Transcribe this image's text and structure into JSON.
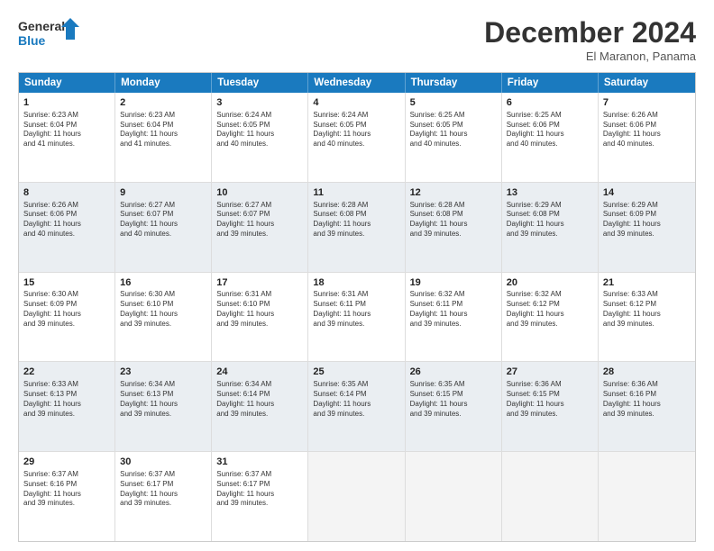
{
  "logo": {
    "line1": "General",
    "line2": "Blue"
  },
  "title": "December 2024",
  "location": "El Maranon, Panama",
  "days_of_week": [
    "Sunday",
    "Monday",
    "Tuesday",
    "Wednesday",
    "Thursday",
    "Friday",
    "Saturday"
  ],
  "weeks": [
    [
      {
        "day": "1",
        "sunrise": "6:23 AM",
        "sunset": "6:04 PM",
        "daylight": "11 hours and 41 minutes."
      },
      {
        "day": "2",
        "sunrise": "6:23 AM",
        "sunset": "6:04 PM",
        "daylight": "11 hours and 41 minutes."
      },
      {
        "day": "3",
        "sunrise": "6:24 AM",
        "sunset": "6:05 PM",
        "daylight": "11 hours and 40 minutes."
      },
      {
        "day": "4",
        "sunrise": "6:24 AM",
        "sunset": "6:05 PM",
        "daylight": "11 hours and 40 minutes."
      },
      {
        "day": "5",
        "sunrise": "6:25 AM",
        "sunset": "6:05 PM",
        "daylight": "11 hours and 40 minutes."
      },
      {
        "day": "6",
        "sunrise": "6:25 AM",
        "sunset": "6:06 PM",
        "daylight": "11 hours and 40 minutes."
      },
      {
        "day": "7",
        "sunrise": "6:26 AM",
        "sunset": "6:06 PM",
        "daylight": "11 hours and 40 minutes."
      }
    ],
    [
      {
        "day": "8",
        "sunrise": "6:26 AM",
        "sunset": "6:06 PM",
        "daylight": "11 hours and 40 minutes."
      },
      {
        "day": "9",
        "sunrise": "6:27 AM",
        "sunset": "6:07 PM",
        "daylight": "11 hours and 40 minutes."
      },
      {
        "day": "10",
        "sunrise": "6:27 AM",
        "sunset": "6:07 PM",
        "daylight": "11 hours and 39 minutes."
      },
      {
        "day": "11",
        "sunrise": "6:28 AM",
        "sunset": "6:08 PM",
        "daylight": "11 hours and 39 minutes."
      },
      {
        "day": "12",
        "sunrise": "6:28 AM",
        "sunset": "6:08 PM",
        "daylight": "11 hours and 39 minutes."
      },
      {
        "day": "13",
        "sunrise": "6:29 AM",
        "sunset": "6:08 PM",
        "daylight": "11 hours and 39 minutes."
      },
      {
        "day": "14",
        "sunrise": "6:29 AM",
        "sunset": "6:09 PM",
        "daylight": "11 hours and 39 minutes."
      }
    ],
    [
      {
        "day": "15",
        "sunrise": "6:30 AM",
        "sunset": "6:09 PM",
        "daylight": "11 hours and 39 minutes."
      },
      {
        "day": "16",
        "sunrise": "6:30 AM",
        "sunset": "6:10 PM",
        "daylight": "11 hours and 39 minutes."
      },
      {
        "day": "17",
        "sunrise": "6:31 AM",
        "sunset": "6:10 PM",
        "daylight": "11 hours and 39 minutes."
      },
      {
        "day": "18",
        "sunrise": "6:31 AM",
        "sunset": "6:11 PM",
        "daylight": "11 hours and 39 minutes."
      },
      {
        "day": "19",
        "sunrise": "6:32 AM",
        "sunset": "6:11 PM",
        "daylight": "11 hours and 39 minutes."
      },
      {
        "day": "20",
        "sunrise": "6:32 AM",
        "sunset": "6:12 PM",
        "daylight": "11 hours and 39 minutes."
      },
      {
        "day": "21",
        "sunrise": "6:33 AM",
        "sunset": "6:12 PM",
        "daylight": "11 hours and 39 minutes."
      }
    ],
    [
      {
        "day": "22",
        "sunrise": "6:33 AM",
        "sunset": "6:13 PM",
        "daylight": "11 hours and 39 minutes."
      },
      {
        "day": "23",
        "sunrise": "6:34 AM",
        "sunset": "6:13 PM",
        "daylight": "11 hours and 39 minutes."
      },
      {
        "day": "24",
        "sunrise": "6:34 AM",
        "sunset": "6:14 PM",
        "daylight": "11 hours and 39 minutes."
      },
      {
        "day": "25",
        "sunrise": "6:35 AM",
        "sunset": "6:14 PM",
        "daylight": "11 hours and 39 minutes."
      },
      {
        "day": "26",
        "sunrise": "6:35 AM",
        "sunset": "6:15 PM",
        "daylight": "11 hours and 39 minutes."
      },
      {
        "day": "27",
        "sunrise": "6:36 AM",
        "sunset": "6:15 PM",
        "daylight": "11 hours and 39 minutes."
      },
      {
        "day": "28",
        "sunrise": "6:36 AM",
        "sunset": "6:16 PM",
        "daylight": "11 hours and 39 minutes."
      }
    ],
    [
      {
        "day": "29",
        "sunrise": "6:37 AM",
        "sunset": "6:16 PM",
        "daylight": "11 hours and 39 minutes."
      },
      {
        "day": "30",
        "sunrise": "6:37 AM",
        "sunset": "6:17 PM",
        "daylight": "11 hours and 39 minutes."
      },
      {
        "day": "31",
        "sunrise": "6:37 AM",
        "sunset": "6:17 PM",
        "daylight": "11 hours and 39 minutes."
      },
      null,
      null,
      null,
      null
    ]
  ]
}
